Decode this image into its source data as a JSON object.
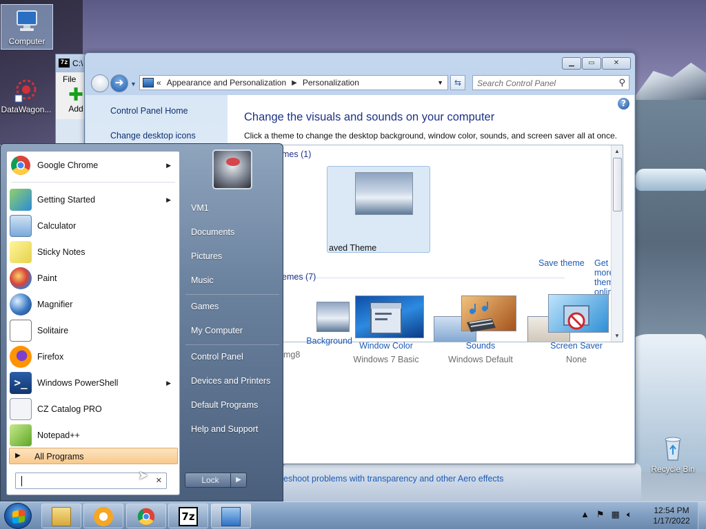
{
  "desktop": {
    "icons": [
      {
        "label": "Computer"
      },
      {
        "label": "DataWagon..."
      },
      {
        "label": "Recycle Bin"
      }
    ]
  },
  "bg_window": {
    "title": "C:\\",
    "menu_file": "File",
    "add_label": "Add"
  },
  "control_panel": {
    "breadcrumb": [
      "Appearance and Personalization",
      "Personalization"
    ],
    "breadcrumb_prefix": "«",
    "search_placeholder": "Search Control Panel",
    "left_links": [
      "Control Panel Home",
      "Change desktop icons"
    ],
    "heading": "Change the visuals and sounds on your computer",
    "subheading": "Click a theme to change the desktop background, window color, sounds, and screen saver all at once.",
    "my_themes_label": "mes (1)",
    "saved_theme_label": "aved Theme",
    "save_theme_link": "Save theme",
    "more_themes_link": "Get more themes online",
    "aero_themes_label": "emes (7)",
    "settings": [
      {
        "name": "Background",
        "value": "mg8"
      },
      {
        "name": "Window Color",
        "value": "Windows 7 Basic"
      },
      {
        "name": "Sounds",
        "value": "Windows Default"
      },
      {
        "name": "Screen Saver",
        "value": "None"
      }
    ],
    "troubleshoot_link": "eshoot problems with transparency and other Aero effects"
  },
  "start_menu": {
    "programs": [
      {
        "label": "Google Chrome",
        "submenu": true
      },
      {
        "label": "Getting Started",
        "submenu": true
      },
      {
        "label": "Calculator",
        "submenu": false
      },
      {
        "label": "Sticky Notes",
        "submenu": false
      },
      {
        "label": "Paint",
        "submenu": false
      },
      {
        "label": "Magnifier",
        "submenu": false
      },
      {
        "label": "Solitaire",
        "submenu": false
      },
      {
        "label": "Firefox",
        "submenu": false
      },
      {
        "label": "Windows PowerShell",
        "submenu": true
      },
      {
        "label": "CZ Catalog PRO",
        "submenu": false
      },
      {
        "label": "Notepad++",
        "submenu": false
      }
    ],
    "all_programs": "All Programs",
    "right_links": [
      "VM1",
      "Documents",
      "Pictures",
      "Music",
      "Games",
      "My Computer",
      "Control Panel",
      "Devices and Printers",
      "Default Programs",
      "Help and Support"
    ],
    "lock_label": "Lock"
  },
  "taskbar": {
    "time": "12:54 PM",
    "date": "1/17/2022"
  }
}
